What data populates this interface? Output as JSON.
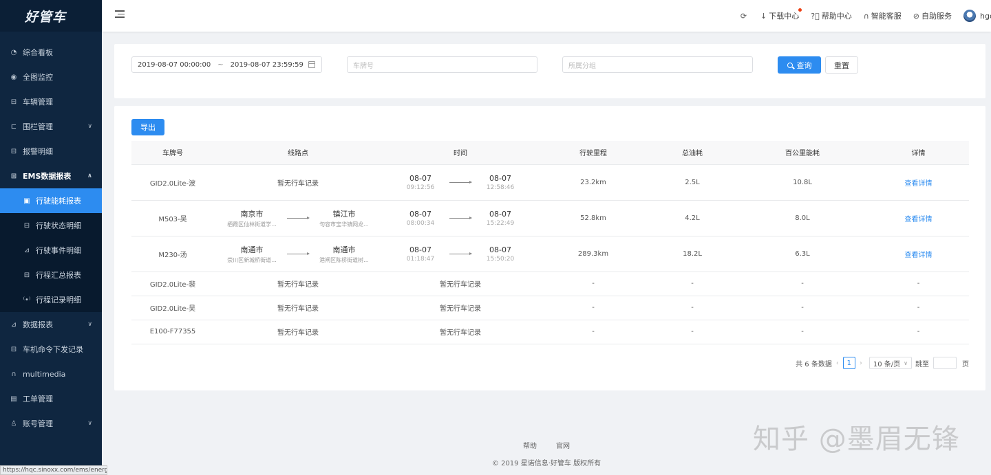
{
  "app": {
    "logo": "好管车"
  },
  "sidebar": {
    "items": [
      {
        "label": "综合看板",
        "icon": "dashboard-icon"
      },
      {
        "label": "全图监控",
        "icon": "location-pin-icon"
      },
      {
        "label": "车辆管理",
        "icon": "car-icon"
      },
      {
        "label": "围栏管理",
        "icon": "fence-icon"
      },
      {
        "label": "报警明细",
        "icon": "alarm-icon"
      },
      {
        "label": "EMS数据报表",
        "icon": "ems-icon"
      },
      {
        "label": "数据报表",
        "icon": "chart-line-icon"
      },
      {
        "label": "车机命令下发记录",
        "icon": "command-icon"
      },
      {
        "label": "multimedia",
        "icon": "headphone-icon"
      },
      {
        "label": "工单管理",
        "icon": "ticket-icon"
      },
      {
        "label": "账号管理",
        "icon": "user-icon"
      }
    ],
    "ems_sub": [
      {
        "label": "行驶能耗报表"
      },
      {
        "label": "行驶状态明细"
      },
      {
        "label": "行驶事件明细"
      },
      {
        "label": "行程汇总报表"
      },
      {
        "label": "行程记录明细"
      }
    ]
  },
  "status_url": "https://hqc.sinoxx.com/ems/energy",
  "header": {
    "download": "下载中心",
    "help": "帮助中心",
    "service": "智能客服",
    "self_service": "自助服务",
    "user": "hgc"
  },
  "filters": {
    "date_start": "2019-08-07 00:00:00",
    "date_sep": "~",
    "date_end": "2019-08-07 23:59:59",
    "plate_placeholder": "车牌号",
    "group_placeholder": "所属分组",
    "query_label": "查询",
    "reset_label": "重置"
  },
  "export_label": "导出",
  "table": {
    "headers": [
      "车牌号",
      "线路点",
      "时间",
      "行驶里程",
      "总油耗",
      "百公里能耗",
      "详情"
    ],
    "detail_link": "查看详情",
    "no_record": "暂无行车记录",
    "rows": [
      {
        "plate": "GID2.0Lite-波",
        "start_date": "08-07",
        "start_time": "09:12:56",
        "end_date": "08-07",
        "end_time": "12:58:46",
        "mileage": "23.2km",
        "fuel": "2.5L",
        "per100": "10.8L"
      },
      {
        "plate": "M503-吴",
        "from_city": "南京市",
        "from_addr": "栖霞区仙林街道学...",
        "to_city": "镇江市",
        "to_addr": "句容市宝华镇网龙...",
        "start_date": "08-07",
        "start_time": "08:00:34",
        "end_date": "08-07",
        "end_time": "15:22:49",
        "mileage": "52.8km",
        "fuel": "4.2L",
        "per100": "8.0L"
      },
      {
        "plate": "M230-汤",
        "from_city": "南通市",
        "from_addr": "崇川区新城桥街道...",
        "to_city": "南通市",
        "to_addr": "港闸区陈桥街道树...",
        "start_date": "08-07",
        "start_time": "01:18:47",
        "end_date": "08-07",
        "end_time": "15:50:20",
        "mileage": "289.3km",
        "fuel": "18.2L",
        "per100": "6.3L"
      },
      {
        "plate": "GID2.0Lite-裴",
        "mileage": "-",
        "fuel": "-",
        "per100": "-",
        "detail": "-"
      },
      {
        "plate": "GID2.0Lite-吴",
        "mileage": "-",
        "fuel": "-",
        "per100": "-",
        "detail": "-"
      },
      {
        "plate": "E100-F77355",
        "mileage": "-",
        "fuel": "-",
        "per100": "-",
        "detail": "-"
      }
    ]
  },
  "pager": {
    "total_text": "共 6 条数据",
    "current_page": "1",
    "page_size": "10 条/页",
    "jump_label": "跳至",
    "page_suffix": "页"
  },
  "footer": {
    "help": "帮助",
    "official": "官网",
    "copyright": "© 2019 星诺信息·好管车 版权所有"
  },
  "watermark": "知乎 @墨眉无锋"
}
